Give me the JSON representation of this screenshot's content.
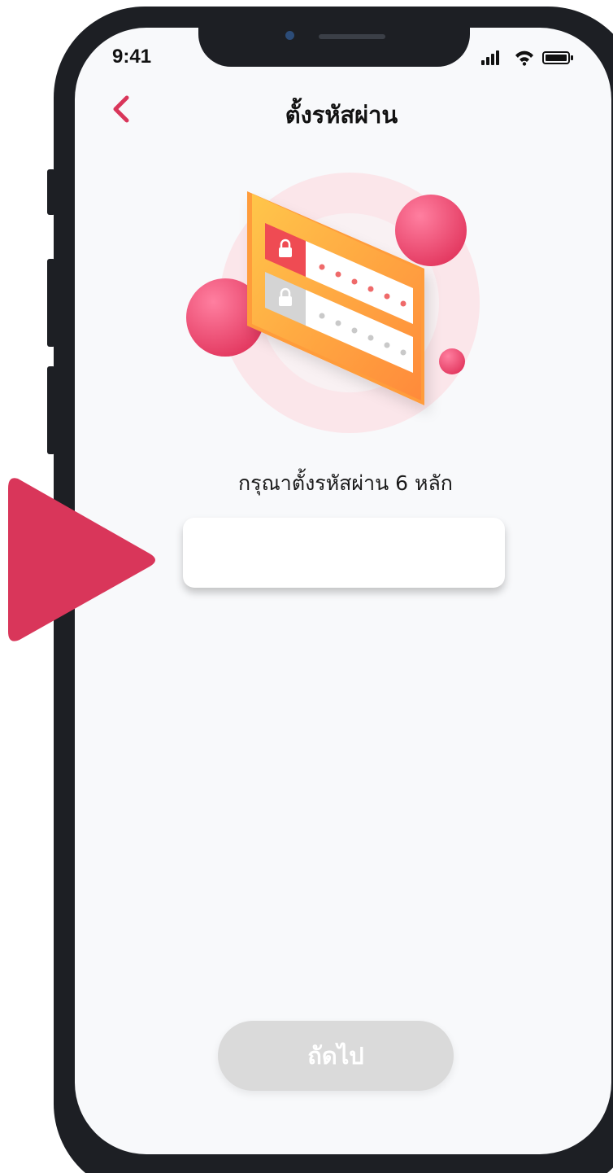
{
  "status_bar": {
    "time": "9:41",
    "icons": [
      "signal-icon",
      "wifi-icon",
      "battery-icon"
    ]
  },
  "header": {
    "back_icon": "chevron-left-icon",
    "title": "ตั้งรหัสผ่าน"
  },
  "illustration": {
    "description_icon": "password-lock-card-icon",
    "rows": [
      {
        "state": "active",
        "lock": "lock-icon",
        "dots": 6
      },
      {
        "state": "inactive",
        "lock": "lock-icon",
        "dots": 6
      }
    ]
  },
  "form": {
    "instruction": "กรุณาตั้งรหัสผ่าน 6 หลัก",
    "pin_value": "",
    "pin_placeholder": ""
  },
  "actions": {
    "next_label": "ถัดไป"
  },
  "colors": {
    "accent": "#d9365a",
    "screen_bg": "#f8f9fb",
    "button_disabled": "#dadada",
    "card_orange": "#ffb23f",
    "frame": "#1d1f24"
  },
  "overlay": {
    "pointer_icon": "play-triangle-icon"
  }
}
